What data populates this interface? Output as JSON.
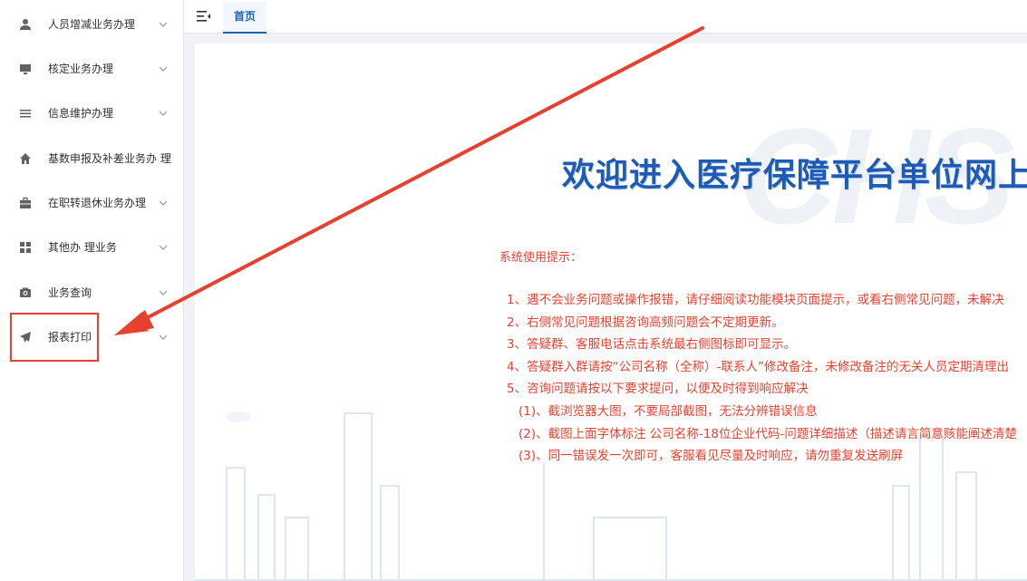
{
  "sidebar": {
    "items": [
      {
        "label": "人员增减业务办理",
        "icon": "user-icon"
      },
      {
        "label": "核定业务办理",
        "icon": "monitor-icon"
      },
      {
        "label": "信息维护办理",
        "icon": "list-icon"
      },
      {
        "label": "基数申报及补差业务办 理",
        "icon": "home-icon"
      },
      {
        "label": "在职转退休业务办理",
        "icon": "briefcase-icon"
      },
      {
        "label": "其他办 理业务",
        "icon": "grid-icon"
      },
      {
        "label": "业务查询",
        "icon": "camera-icon"
      },
      {
        "label": "报表打印",
        "icon": "send-icon"
      }
    ]
  },
  "topbar": {
    "home_tab": "首页"
  },
  "main": {
    "welcome": "欢迎进入医疗保障平台单位网上",
    "watermark": "CHS",
    "tips_title": "系统使用提示：",
    "tips": [
      "1、遇不会业务问题或操作报错，请仔细阅读功能模块页面提示，或看右侧常见问题，未解决",
      "2、右侧常见问题根据咨询高频问题会不定期更新。",
      "3、答疑群、客服电话点击系统最右侧图标即可显示。",
      "4、答疑群入群请按“公司名称（全称）-联系人”修改备注，未修改备注的无关人员定期清理出",
      "5、咨询问题请按以下要求提问，以便及时得到响应解决",
      "(1)、截浏览器大图，不要局部截图，无法分辨错误信息",
      "(2)、截图上面字体标注 公司名称-18位企业代码-问题详细描述（描述请言简意赅能阐述清楚",
      "(3)、同一错误发一次即可，客服看见尽量及时响应，请勿重复发送刷屏"
    ]
  },
  "colors": {
    "accent": "#1e5fb8",
    "annotation": "#e8402f",
    "tip_text": "#e8412f"
  }
}
